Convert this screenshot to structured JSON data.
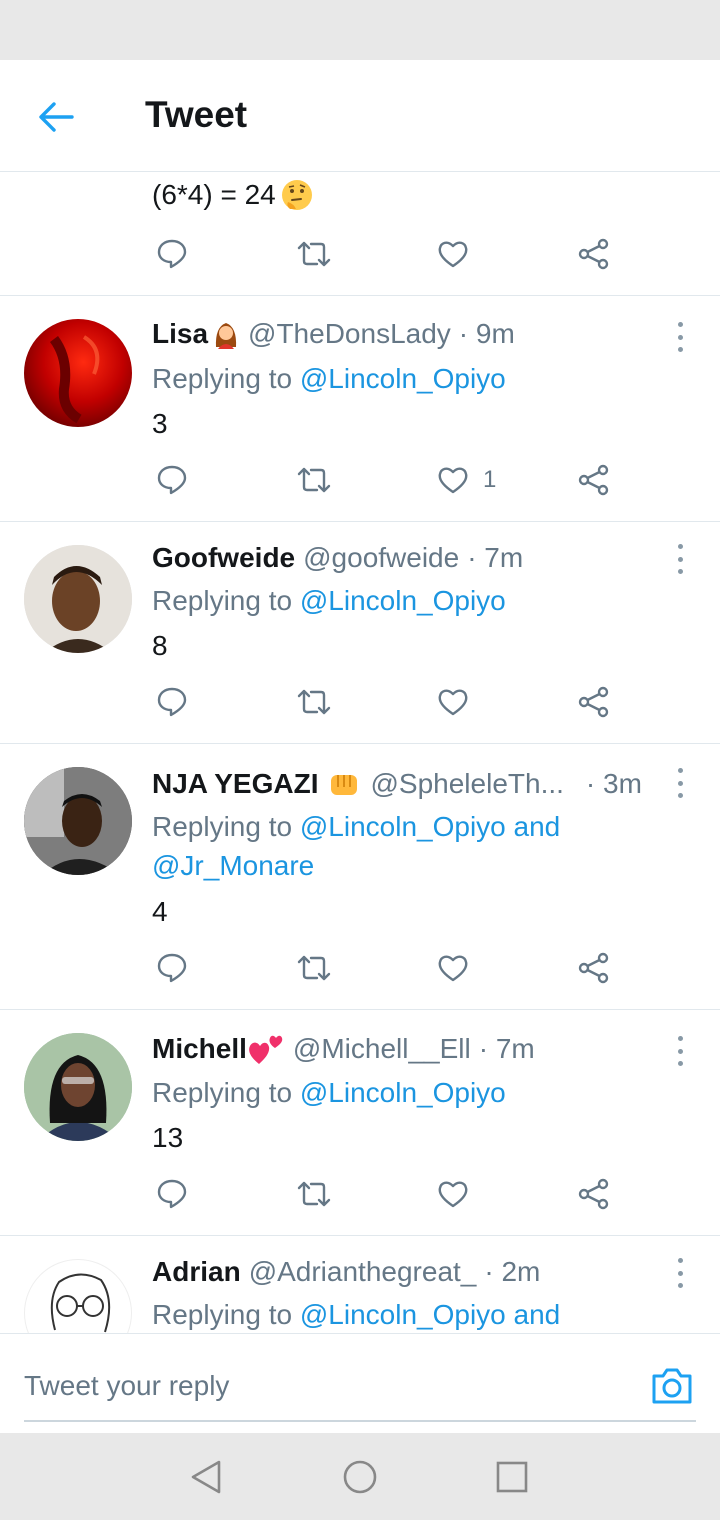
{
  "header": {
    "title": "Tweet"
  },
  "partial_tweet": {
    "text": "(6*4) = 24"
  },
  "replies": [
    {
      "name": "Lisa",
      "handle": "@TheDonsLady",
      "time": "· 9m",
      "reply_prefix": "Replying to",
      "mention1": "@Lincoln_Opiyo",
      "text": "3",
      "like_count": "1"
    },
    {
      "name": "Goofweide",
      "handle": "@goofweide",
      "time": "· 7m",
      "reply_prefix": "Replying to",
      "mention1": "@Lincoln_Opiyo",
      "text": "8"
    },
    {
      "name": "NJA YEGAZI",
      "handle": "@SpheleleTh...",
      "time": "· 3m",
      "reply_prefix": "Replying to",
      "mention1": "@Lincoln_Opiyo",
      "conj": "and",
      "mention2": "@Jr_Monare",
      "text": "4"
    },
    {
      "name": "Michell",
      "handle": "@Michell__Ell",
      "time": "· 7m",
      "reply_prefix": "Replying to",
      "mention1": "@Lincoln_Opiyo",
      "text": "13"
    },
    {
      "name": "Adrian",
      "handle": "@Adrianthegreat_",
      "time": "· 2m",
      "reply_prefix": "Replying to",
      "mention1": "@Lincoln_Opiyo",
      "conj": "and"
    }
  ],
  "composer": {
    "placeholder": "Tweet your reply"
  },
  "colors": {
    "accent": "#1da1f2",
    "mention": "#1b95e0",
    "secondary_text": "#657786",
    "divider": "#e1e8ed"
  },
  "icons": [
    "back-arrow-icon",
    "reply-icon",
    "retweet-icon",
    "like-icon",
    "share-icon",
    "more-icon",
    "camera-icon",
    "nav-back-icon",
    "nav-home-icon",
    "nav-recents-icon"
  ]
}
